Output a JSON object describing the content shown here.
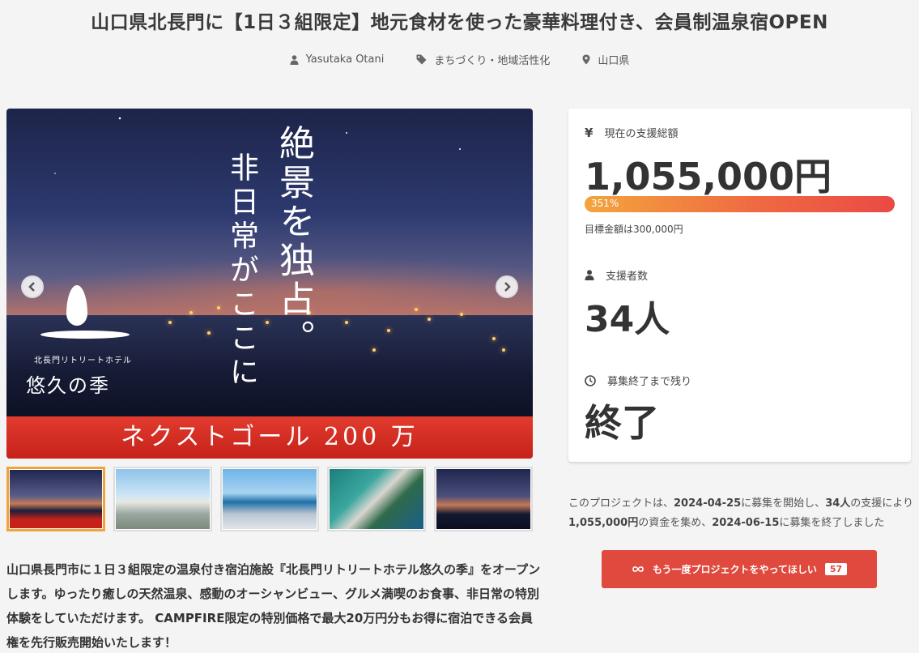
{
  "project": {
    "title": "山口県北長門に【1日３組限定】地元食材を使った豪華料理付き、会員制温泉宿OPEN",
    "owner": "Yasutaka Otani",
    "category": "まちづくり・地域活性化",
    "location": "山口県"
  },
  "hero": {
    "copy_main": "絶景を独占。",
    "copy_sub": "非日常がここに",
    "hotel_sub": "北長門リトリートホテル",
    "hotel_name": "悠久の季",
    "banner": "ネクストゴール 200 万"
  },
  "thumbnails": [
    {
      "label": "thumb-1",
      "active": true
    },
    {
      "label": "thumb-2",
      "active": false
    },
    {
      "label": "thumb-3",
      "active": false
    },
    {
      "label": "thumb-4",
      "active": false
    },
    {
      "label": "thumb-5",
      "active": false
    }
  ],
  "description": "山口県長門市に１日３組限定の温泉付き宿泊施設『北長門リトリートホテル悠久の季』をオープンします。ゆったり癒しの天然温泉、感動のオーシャンビュー、グルメ満喫のお食事、非日常の特別体験をしていただけます。 CAMPFIRE限定の特別価格で最大20万円分もお得に宿泊できる会員権を先行販売開始いたします！",
  "stats": {
    "funding_label": "現在の支援総額",
    "funding_amount": "1,055,000円",
    "progress_label": "351%",
    "progress_percent": 351,
    "goal_text": "目標金額は300,000円",
    "backers_label": "支援者数",
    "backers_value": "34人",
    "remaining_label": "募集終了まで残り",
    "remaining_value": "終了"
  },
  "summary": {
    "prefix": "このプロジェクトは、",
    "start_date": "2024-04-25",
    "mid1": "に募集を開始し、",
    "backers": "34人",
    "mid2": "の支援により",
    "amount": "1,055,000円",
    "mid3": "の資金を集め、",
    "end_date": "2024-06-15",
    "suffix": "に募集を終了しました"
  },
  "cta": {
    "label": "もう一度プロジェクトをやってほしい",
    "count": "57"
  },
  "colors": {
    "accent": "#e04a3e",
    "progress_start": "#f3a53d",
    "progress_end": "#ea4a45",
    "active_thumb_border": "#f0a53a"
  }
}
